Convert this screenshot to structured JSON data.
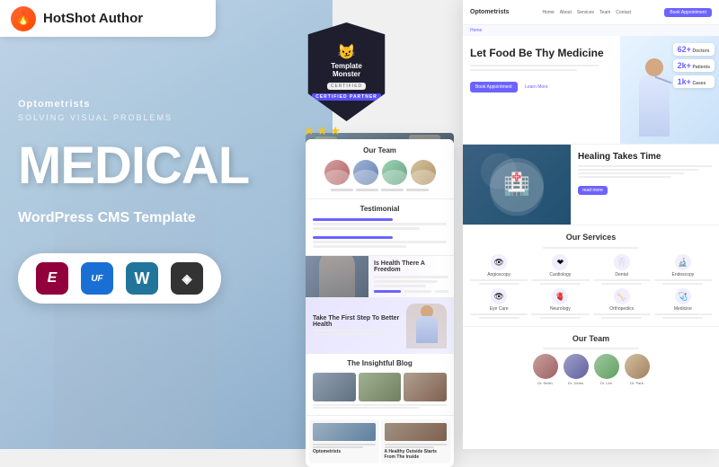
{
  "header": {
    "title": "HotShot Author",
    "logo_emoji": "🔥"
  },
  "badge": {
    "brand": "TemplateMonster",
    "certified_label": "CERTIFIED PARTNER",
    "stars": [
      "★",
      "★",
      "★"
    ]
  },
  "left_panel": {
    "subtitle": "Optometrists",
    "desc": "SOLVING VISUAL PROBLEMS",
    "main_title": "MEDICAL",
    "template_label": "WordPress CMS Template"
  },
  "plugins": [
    {
      "name": "Elementor",
      "short": "E",
      "color_class": "plugin-elementor"
    },
    {
      "name": "Ultimate Addons",
      "short": "uf",
      "color_class": "plugin-uf"
    },
    {
      "name": "WordPress",
      "short": "W",
      "color_class": "plugin-wp"
    },
    {
      "name": "Revolution Slider",
      "short": "R",
      "color_class": "plugin-rev"
    }
  ],
  "right_preview": {
    "nav_logo": "Optometrists",
    "nav_links": [
      "Home",
      "About",
      "Services",
      "Team",
      "Contact"
    ],
    "nav_btn": "Book Appointment",
    "hero_title": "Let Food Be Thy Medicine",
    "hero_btn1": "Book Appointment",
    "hero_btn2": "Learn More",
    "stats": [
      {
        "num": "62+",
        "label": "Doctors"
      },
      {
        "num": "2k+",
        "label": "Patients"
      },
      {
        "num": "1k+",
        "label": "Cases"
      }
    ],
    "healing_title": "Healing Takes Time",
    "services_title": "Our Services",
    "services": [
      {
        "icon": "👁",
        "label": "Angioscopy"
      },
      {
        "icon": "❤",
        "label": "Cardiology"
      },
      {
        "icon": "🦷",
        "label": "Dental"
      },
      {
        "icon": "🔬",
        "label": "Endoscopy"
      },
      {
        "icon": "👁",
        "label": "Eye Care"
      },
      {
        "icon": "🫀",
        "label": "Neurology"
      },
      {
        "icon": "🦴",
        "label": "Orthopedics"
      },
      {
        "icon": "🩺",
        "label": "Medicine"
      }
    ],
    "team_title": "Our Team"
  },
  "center_preview": {
    "team_title": "Our Team",
    "testimonial_title": "Testimonial",
    "health_title": "Is Health There A Freedom",
    "blog_title": "The Insightful Blog",
    "hero_section_title": "Take The First Step To Better Health",
    "bottom_col1": "Optometrists",
    "bottom_col2": "A Healthy Outside Starts From The Inside"
  }
}
